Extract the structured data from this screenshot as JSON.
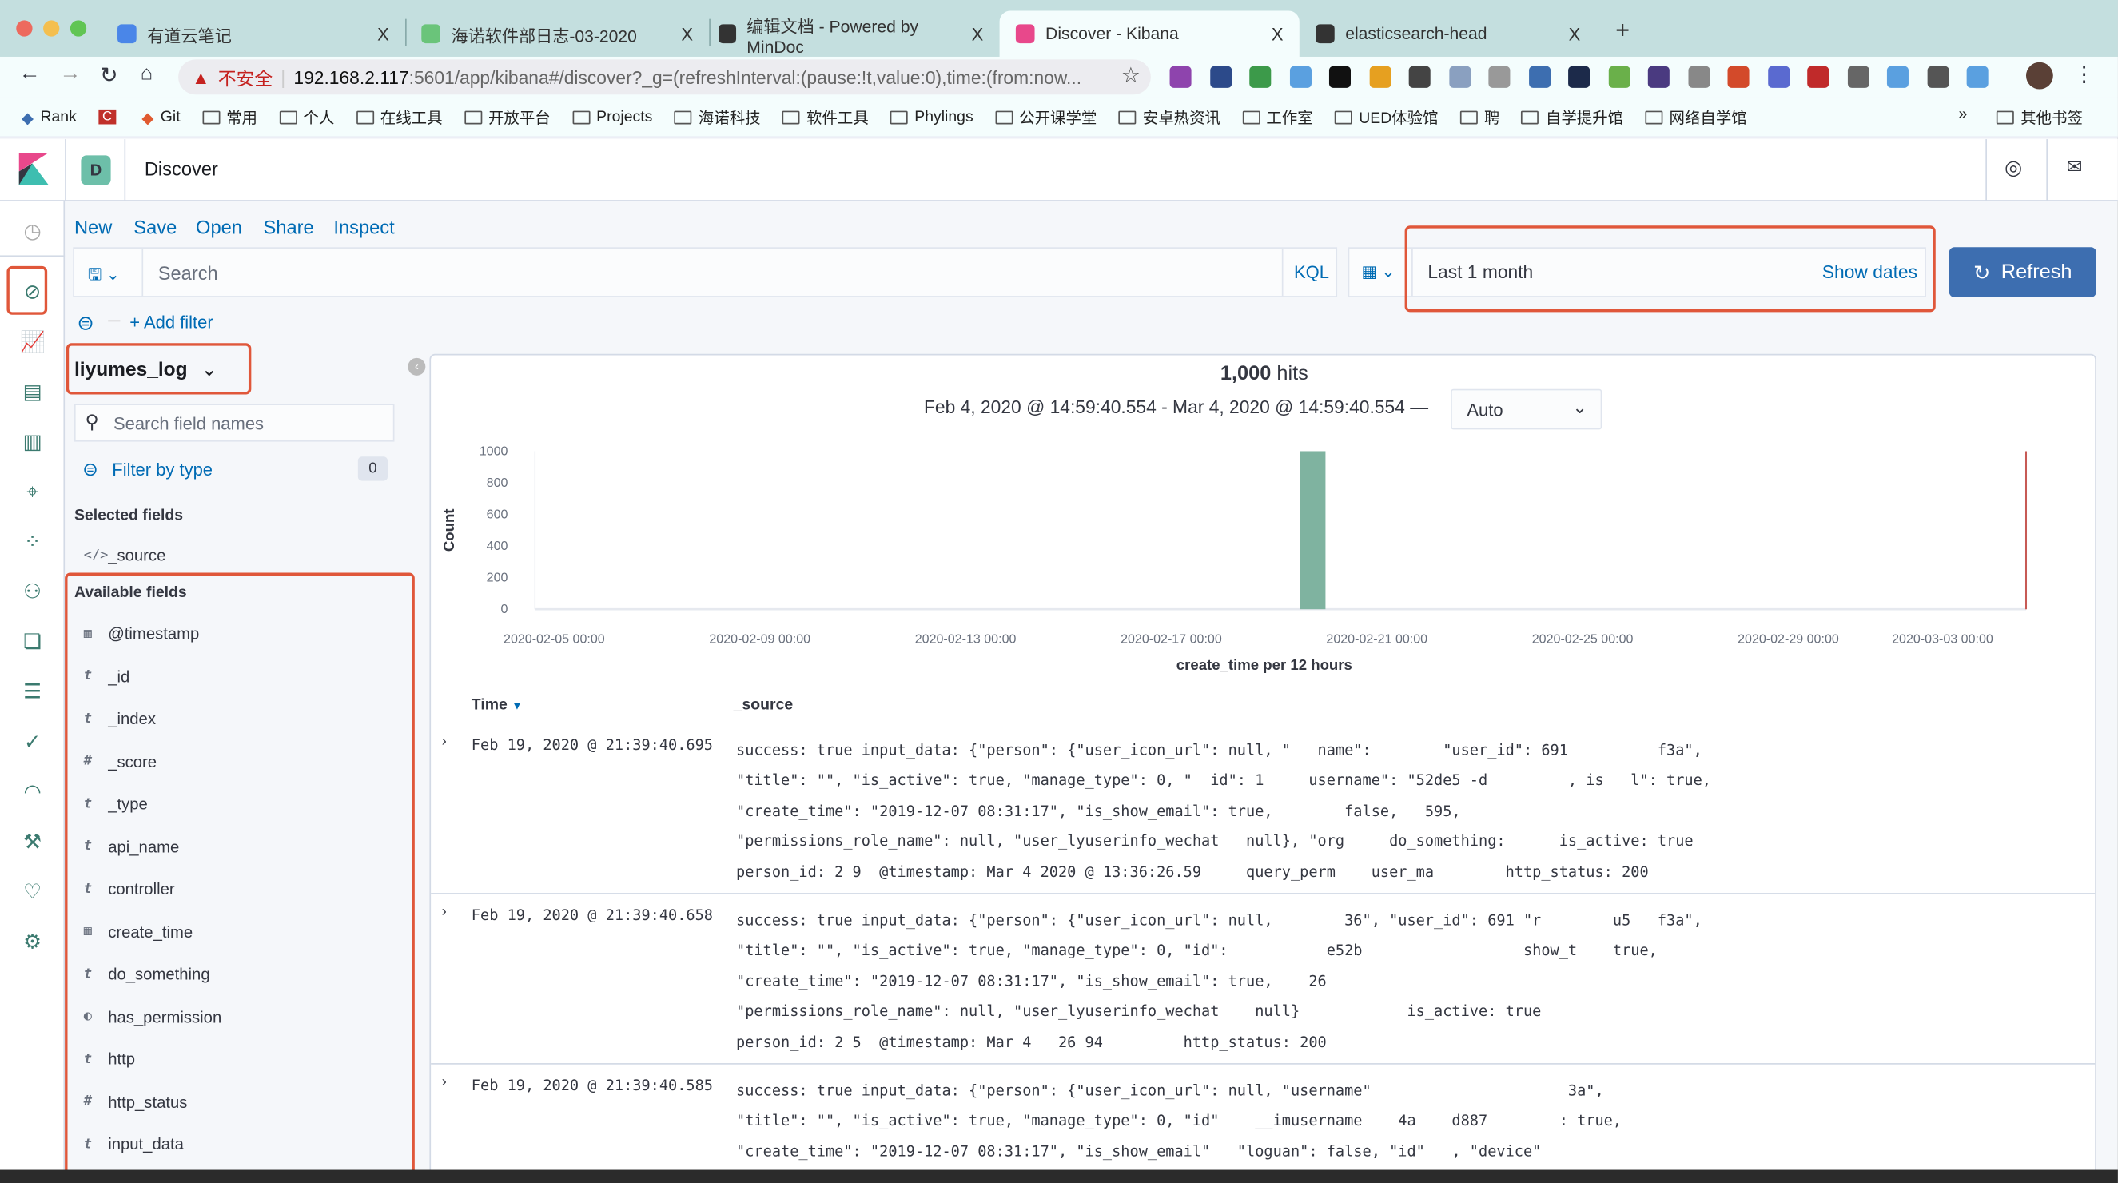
{
  "browser": {
    "tabs": [
      {
        "title": "有道云笔记",
        "color": "#4a86e8"
      },
      {
        "title": "海诺软件部日志-03-2020",
        "color": "#6ac47a"
      },
      {
        "title": "编辑文档 - Powered by MinDoc",
        "color": "#333333"
      },
      {
        "title": "Discover - Kibana",
        "color": "#e8488b",
        "active": true
      },
      {
        "title": "elasticsearch-head",
        "color": "#333333"
      }
    ],
    "close_glyph": "X",
    "new_tab": "+",
    "security_warning": "不安全",
    "url_host": "192.168.2.117",
    "url_rest": ":5601/app/kibana#/discover?_g=(refreshInterval:(pause:!t,value:0),time:(from:now...",
    "bookmarks": [
      "Rank",
      "Git",
      "常用",
      "个人",
      "在线工具",
      "开放平台",
      "Projects",
      "海诺科技",
      "软件工具",
      "Phylings",
      "公开课学堂",
      "安卓热资讯",
      "工作室",
      "UED体验馆",
      "聘",
      "自学提升馆",
      "网络自学馆"
    ],
    "bookmarks_more": "»",
    "other_bookmarks": "其他书签"
  },
  "kibana": {
    "space_initial": "D",
    "app_title": "Discover",
    "menu": [
      "New",
      "Save",
      "Open",
      "Share",
      "Inspect"
    ],
    "search_placeholder": "Search",
    "kql": "KQL",
    "time_range": "Last 1 month",
    "show_dates": "Show dates",
    "refresh": "Refresh",
    "add_filter": "+ Add filter",
    "accent": "#006bb4",
    "refresh_color": "#3d6eb0"
  },
  "sidebar": {
    "index_pattern": "liyumes_log",
    "field_search_placeholder": "Search field names",
    "filter_by_type": "Filter by type",
    "filter_count": "0",
    "selected_heading": "Selected fields",
    "selected": [
      {
        "type": "</>",
        "name": "_source"
      }
    ],
    "available_heading": "Available fields",
    "available": [
      {
        "type": "date",
        "name": "@timestamp"
      },
      {
        "type": "t",
        "name": "_id"
      },
      {
        "type": "t",
        "name": "_index"
      },
      {
        "type": "#",
        "name": "_score"
      },
      {
        "type": "t",
        "name": "_type"
      },
      {
        "type": "t",
        "name": "api_name"
      },
      {
        "type": "t",
        "name": "controller"
      },
      {
        "type": "date",
        "name": "create_time"
      },
      {
        "type": "t",
        "name": "do_something"
      },
      {
        "type": "bool",
        "name": "has_permission"
      },
      {
        "type": "t",
        "name": "http"
      },
      {
        "type": "#",
        "name": "http_status"
      },
      {
        "type": "t",
        "name": "input_data"
      }
    ]
  },
  "results": {
    "hits": "1,000",
    "hits_label": "hits",
    "range": "Feb 4, 2020 @ 14:59:40.554 - Mar 4, 2020 @ 14:59:40.554 —",
    "interval": "Auto",
    "col_time": "Time",
    "col_source": "_source",
    "docs": [
      {
        "time": "Feb 19, 2020 @ 21:39:40.695",
        "lines": [
          "success: true input_data: {\"person\": {\"user_icon_url\": null, \"   name\":        \"user_id\": 691          f3a\",",
          "\"title\": \"\", \"is_active\": true, \"manage_type\": 0, \"  id\": 1     username\": \"52de5 -d         , is   l\": true,",
          "\"create_time\": \"2019-12-07 08:31:17\", \"is_show_email\": true,        false,   595,",
          "\"permissions_role_name\": null, \"user_lyuserinfo_wechat   null}, \"org     do_something:      is_active: true",
          "person_id: 2 9  @timestamp: Mar 4 2020 @ 13:36:26.59     query_perm    user_ma        http_status: 200"
        ]
      },
      {
        "time": "Feb 19, 2020 @ 21:39:40.658",
        "lines": [
          "success: true input_data: {\"person\": {\"user_icon_url\": null,        36\", \"user_id\": 691 \"r        u5   f3a\",",
          "\"title\": \"\", \"is_active\": true, \"manage_type\": 0, \"id\":           e52b                  show_t    true,",
          "\"create_time\": \"2019-12-07 08:31:17\", \"is_show_email\": true,    26",
          "\"permissions_role_name\": null, \"user_lyuserinfo_wechat    null}            is_active: true",
          "person_id: 2 5  @timestamp: Mar 4   26 94         http_status: 200"
        ]
      },
      {
        "time": "Feb 19, 2020 @ 21:39:40.585",
        "lines": [
          "success: true input_data: {\"person\": {\"user_icon_url\": null, \"username\"                      3a\",",
          "\"title\": \"\", \"is_active\": true, \"manage_type\": 0, \"id\"    __imusername    4a    d887        : true,",
          "\"create_time\": \"2019-12-07 08:31:17\", \"is_show_email\"   \"loguan\": false, \"id\"   , \"device\""
        ]
      }
    ]
  },
  "chart_data": {
    "type": "bar",
    "title": "",
    "xlabel": "create_time per 12 hours",
    "ylabel": "Count",
    "ylim": [
      0,
      1000
    ],
    "xlim": [
      "2020-02-04 14:59:40",
      "2020-03-04 14:59:40"
    ],
    "yticks": [
      "0",
      "200",
      "400",
      "600",
      "800",
      "1000"
    ],
    "xticks": [
      "2020-02-05 00:00",
      "2020-02-09 00:00",
      "2020-02-13 00:00",
      "2020-02-17 00:00",
      "2020-02-21 00:00",
      "2020-02-25 00:00",
      "2020-02-29 00:00",
      "2020-03-03 00:00"
    ],
    "bin_hours": 12,
    "x": [
      "2020-02-19 12:00"
    ],
    "values": [
      1000
    ],
    "bar_color": "#7fb3a0",
    "now_marker_color": "#c75a55",
    "grid": false
  }
}
